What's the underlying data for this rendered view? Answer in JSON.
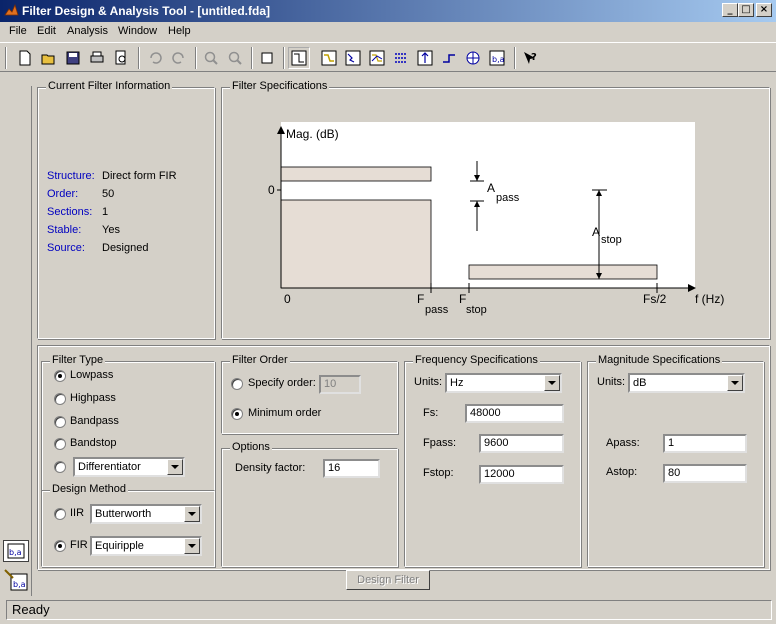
{
  "window": {
    "title": "Filter Design & Analysis Tool - [untitled.fda]",
    "min_glyph": "_",
    "max_glyph": "□",
    "close_glyph": "×"
  },
  "menu": [
    "File",
    "Edit",
    "Analysis",
    "Window",
    "Help"
  ],
  "toolbar": [
    "new-icon",
    "open-icon",
    "save-icon",
    "print-icon",
    "print-preview-icon",
    "undo-icon",
    "redo-icon",
    "zoom-in-icon",
    "zoom-out-icon",
    "full-view-icon",
    "filter-specs-icon",
    "magnitude-response-icon",
    "phase-response-icon",
    "magnitude-phase-icon",
    "group-delay-icon",
    "impulse-response-icon",
    "step-response-icon",
    "pole-zero-icon",
    "coefficients-icon",
    "whats-this-icon"
  ],
  "current_filter_info": {
    "title": "Current Filter Information",
    "rows": [
      {
        "label": "Structure:",
        "value": "Direct form FIR"
      },
      {
        "label": "Order:",
        "value": "50"
      },
      {
        "label": "Sections:",
        "value": "1"
      },
      {
        "label": "Stable:",
        "value": "Yes"
      },
      {
        "label": "Source:",
        "value": "Designed"
      }
    ]
  },
  "filter_specs": {
    "title": "Filter Specifications",
    "ylabel": "Mag. (dB)",
    "zero_label": "0",
    "x0_label": "0",
    "fpass_main": "F",
    "fpass_sub": "pass",
    "fstop_main": "F",
    "fstop_sub": "stop",
    "fs2_label": "Fs/2",
    "xlabel": "f (Hz)",
    "apass_main": "A",
    "apass_sub": "pass",
    "astop_main": "A",
    "astop_sub": "stop",
    "colors": {
      "region": "#e6ddd5",
      "plot_bg": "#ffffff"
    }
  },
  "filter_type": {
    "title": "Filter Type",
    "options": [
      "Lowpass",
      "Highpass",
      "Bandpass",
      "Bandstop"
    ],
    "selected": "Lowpass",
    "other_value": "Differentiator"
  },
  "design_method": {
    "title": "Design Method",
    "iir_label": "IIR",
    "iir_value": "Butterworth",
    "fir_label": "FIR",
    "fir_value": "Equiripple",
    "selected": "FIR"
  },
  "filter_order": {
    "title": "Filter Order",
    "specify_label": "Specify order:",
    "specify_value": "10",
    "minimum_label": "Minimum order",
    "selected": "Minimum order"
  },
  "options": {
    "title": "Options",
    "density_label": "Density factor:",
    "density_value": "16"
  },
  "frequency_specs": {
    "title": "Frequency Specifications",
    "units_label": "Units:",
    "units_value": "Hz",
    "fs_label": "Fs:",
    "fs_value": "48000",
    "fpass_label": "Fpass:",
    "fpass_value": "9600",
    "fstop_label": "Fstop:",
    "fstop_value": "12000"
  },
  "magnitude_specs": {
    "title": "Magnitude Specifications",
    "units_label": "Units:",
    "units_value": "dB",
    "apass_label": "Apass:",
    "apass_value": "1",
    "astop_label": "Astop:",
    "astop_value": "80"
  },
  "design_button": "Design Filter",
  "status": "Ready"
}
